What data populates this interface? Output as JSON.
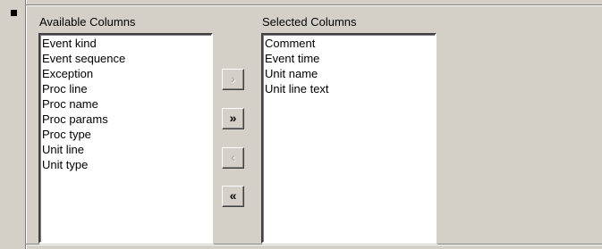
{
  "available_columns": {
    "label": "Available Columns",
    "items": [
      "Event kind",
      "Event sequence",
      "Exception",
      "Proc line",
      "Proc name",
      "Proc params",
      "Proc type",
      "Unit line",
      "Unit type"
    ]
  },
  "selected_columns": {
    "label": "Selected Columns",
    "items": [
      "Comment",
      "Event time",
      "Unit name",
      "Unit line text"
    ]
  },
  "buttons": {
    "add_one": {
      "label": "›",
      "enabled": false
    },
    "add_all": {
      "label": "»",
      "enabled": true
    },
    "remove_one": {
      "label": "‹",
      "enabled": false
    },
    "remove_all": {
      "label": "«",
      "enabled": true
    }
  },
  "colors": {
    "window_bg": "#d4d0c8",
    "list_bg": "#ffffff",
    "disabled_text": "#a0a0a0"
  }
}
